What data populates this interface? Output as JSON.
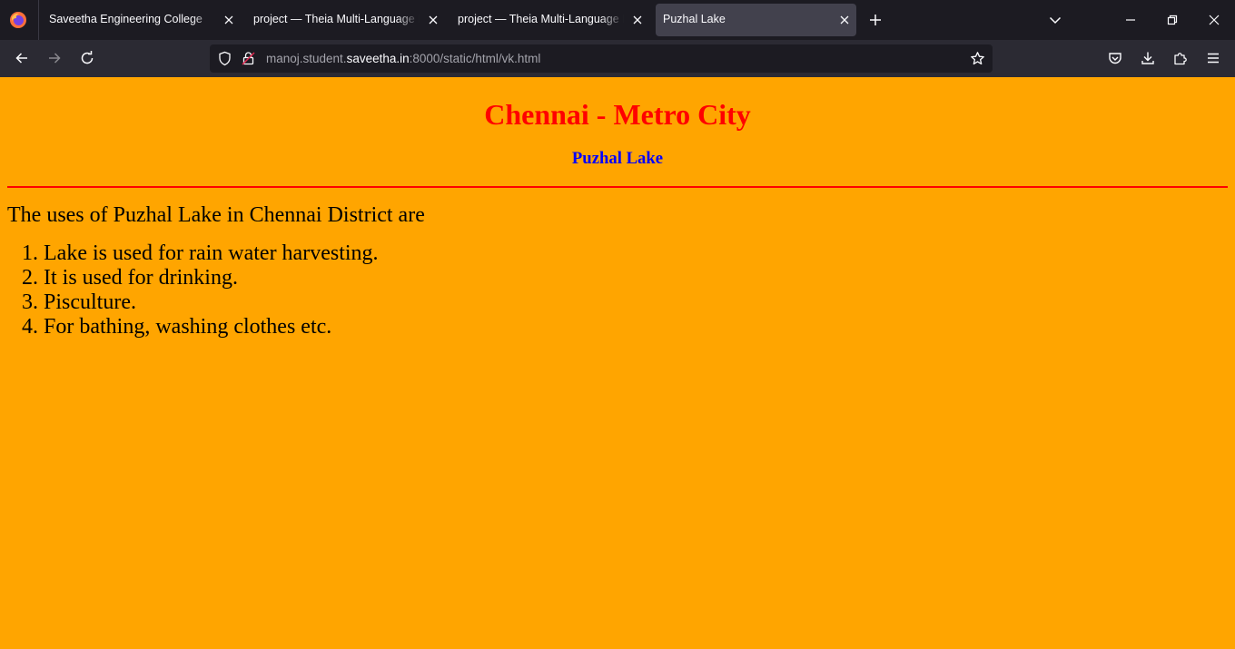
{
  "browser": {
    "tabs": [
      {
        "title": "Saveetha Engineering College",
        "active": false
      },
      {
        "title": "project — Theia Multi-Language Explorer",
        "active": false
      },
      {
        "title": "project — Theia Multi-Language Explorer",
        "active": false
      },
      {
        "title": "Puzhal Lake",
        "active": true
      }
    ],
    "url": {
      "prefix": "manoj.student.",
      "domain": "saveetha.in",
      "suffix": ":8000/static/html/vk.html"
    },
    "icons": {
      "logo": "firefox-logo-icon",
      "new_tab": "plus-icon",
      "list_tabs": "chevron-down-icon",
      "back": "arrow-left-icon",
      "forward": "arrow-right-icon",
      "reload": "reload-icon",
      "tracking": "shield-icon",
      "insecure": "lock-strike-icon",
      "bookmark": "star-icon",
      "pocket": "pocket-icon",
      "downloads": "download-icon",
      "extensions": "puzzle-icon",
      "menu": "hamburger-icon"
    }
  },
  "page": {
    "heading": "Chennai - Metro City",
    "subheading": "Puzhal Lake",
    "intro": "The uses of Puzhal Lake in Chennai District are",
    "uses": [
      "Lake is used for rain water harvesting.",
      "It is used for drinking.",
      "Pisculture.",
      "For bathing, washing clothes etc."
    ]
  },
  "colors": {
    "page_background": "#ffa500",
    "heading": "#ff0000",
    "subheading": "#0000ff",
    "rule": "#ff0000",
    "browser_chrome": "#1c1b22",
    "toolbar": "#2b2a33",
    "active_tab": "#42414d"
  }
}
